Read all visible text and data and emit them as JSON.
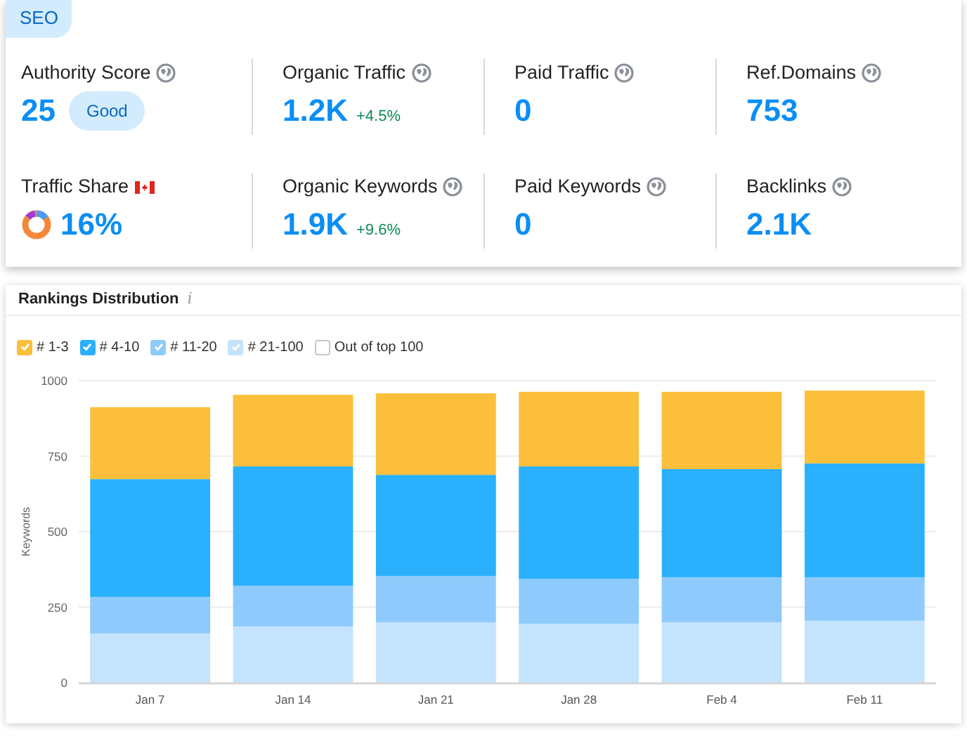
{
  "section_tab": "SEO",
  "metrics": [
    {
      "kind": "standard",
      "label": "Authority Score",
      "value": "25",
      "badge": "Good"
    },
    {
      "kind": "standard",
      "label": "Organic Traffic",
      "value": "1.2K",
      "change": "+4.5%"
    },
    {
      "kind": "standard",
      "label": "Paid Traffic",
      "value": "0"
    },
    {
      "kind": "standard",
      "label": "Ref.Domains",
      "value": "753"
    },
    {
      "kind": "share",
      "label": "Traffic Share",
      "value": "16%"
    },
    {
      "kind": "standard",
      "label": "Organic Keywords",
      "value": "1.9K",
      "change": "+9.6%"
    },
    {
      "kind": "standard",
      "label": "Paid Keywords",
      "value": "0"
    },
    {
      "kind": "standard",
      "label": "Backlinks",
      "value": "2.1K"
    }
  ],
  "rankings": {
    "title": "Rankings Distribution",
    "info": "i",
    "legend_states": [
      {
        "checked": true
      },
      {
        "checked": true
      },
      {
        "checked": true
      },
      {
        "checked": true
      }
    ],
    "extra_legend": {
      "label": "Out of top 100",
      "checked": false
    },
    "chart_data": {
      "type": "bar",
      "stacked": true,
      "grid": true,
      "ylabel": "Keywords",
      "categories": [
        "Jan 7",
        "Jan 14",
        "Jan 21",
        "Jan 28",
        "Feb 4",
        "Feb 11"
      ],
      "ylim": [
        0,
        1000
      ],
      "yticks": [
        0,
        250,
        500,
        750,
        1000
      ],
      "series": [
        {
          "name": "# 1-3",
          "color": "#fbbf3b",
          "values": [
            238,
            237,
            270,
            247,
            256,
            241
          ]
        },
        {
          "name": "# 4-10",
          "color": "#2ab0fc",
          "values": [
            390,
            395,
            335,
            372,
            358,
            377
          ]
        },
        {
          "name": "# 11-20",
          "color": "#8ecbfc",
          "values": [
            121,
            135,
            153,
            149,
            149,
            144
          ]
        },
        {
          "name": "# 21-100",
          "color": "#c4e3fc",
          "values": [
            163,
            186,
            200,
            195,
            200,
            205
          ]
        }
      ]
    }
  }
}
